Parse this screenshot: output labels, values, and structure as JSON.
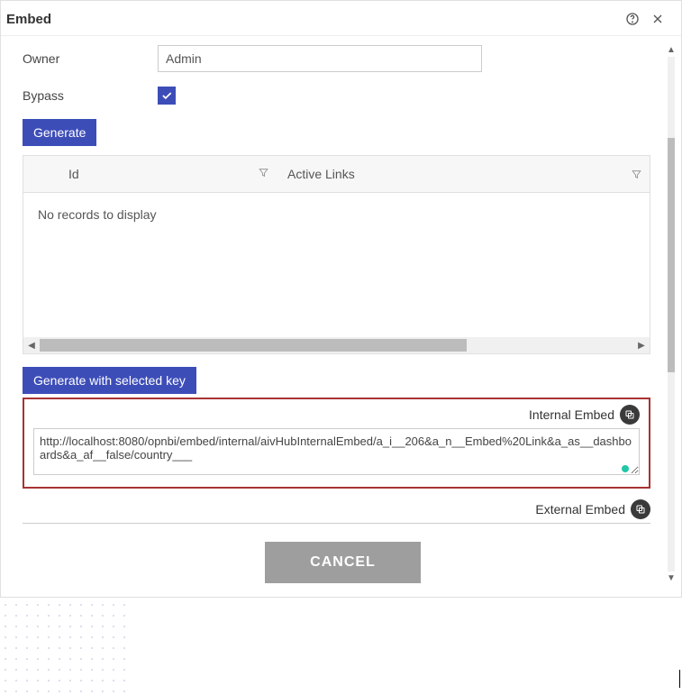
{
  "dialog": {
    "title": "Embed"
  },
  "form": {
    "owner_label": "Owner",
    "owner_value": "Admin",
    "bypass_label": "Bypass",
    "bypass_checked": true
  },
  "buttons": {
    "generate": "Generate",
    "generate_selected": "Generate with selected key",
    "cancel": "CANCEL"
  },
  "table": {
    "col_id": "Id",
    "col_active_links": "Active Links",
    "empty_text": "No records to display"
  },
  "embed": {
    "internal_label": "Internal Embed",
    "internal_url": "http://localhost:8080/opnbi/embed/internal/aivHubInternalEmbed/a_i__206&a_n__Embed%20Link&a_as__dashboards&a_af__false/country___",
    "external_label": "External Embed"
  },
  "colors": {
    "primary": "#3d4db8",
    "highlight_border": "#a83232",
    "status_dot": "#21c7a8",
    "cancel_bg": "#9e9e9e"
  }
}
